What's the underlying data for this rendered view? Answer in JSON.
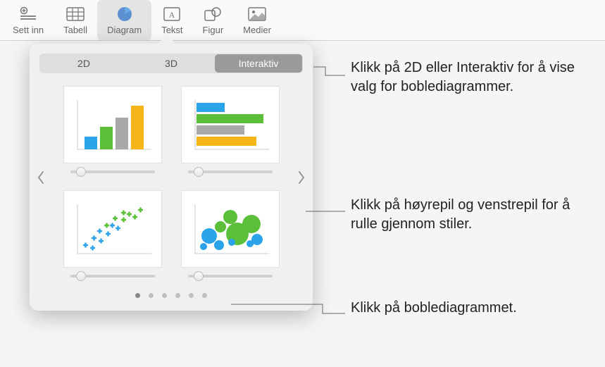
{
  "toolbar": {
    "items": [
      {
        "label": "Sett inn",
        "icon": "insert"
      },
      {
        "label": "Tabell",
        "icon": "table"
      },
      {
        "label": "Diagram",
        "icon": "chart"
      },
      {
        "label": "Tekst",
        "icon": "text"
      },
      {
        "label": "Figur",
        "icon": "shape"
      },
      {
        "label": "Medier",
        "icon": "media"
      }
    ]
  },
  "popover": {
    "tabs": {
      "tab1": "2D",
      "tab2": "3D",
      "tab3": "Interaktiv"
    },
    "charts": [
      "column-chart",
      "horizontal-bar-chart",
      "scatter-chart",
      "bubble-chart"
    ],
    "page_count": 6,
    "selected_page": 0
  },
  "annotations": {
    "a1": "Klikk på 2D eller Interaktiv for å vise valg for boblediagrammer.",
    "a2": "Klikk på høyrepil og venstrepil for å rulle gjennom stiler.",
    "a3": "Klikk på boblediagrammet."
  },
  "colors": {
    "blue": "#2aa3e8",
    "green": "#5bbf3a",
    "gray": "#a8a8a8",
    "yellow": "#f5b516"
  }
}
